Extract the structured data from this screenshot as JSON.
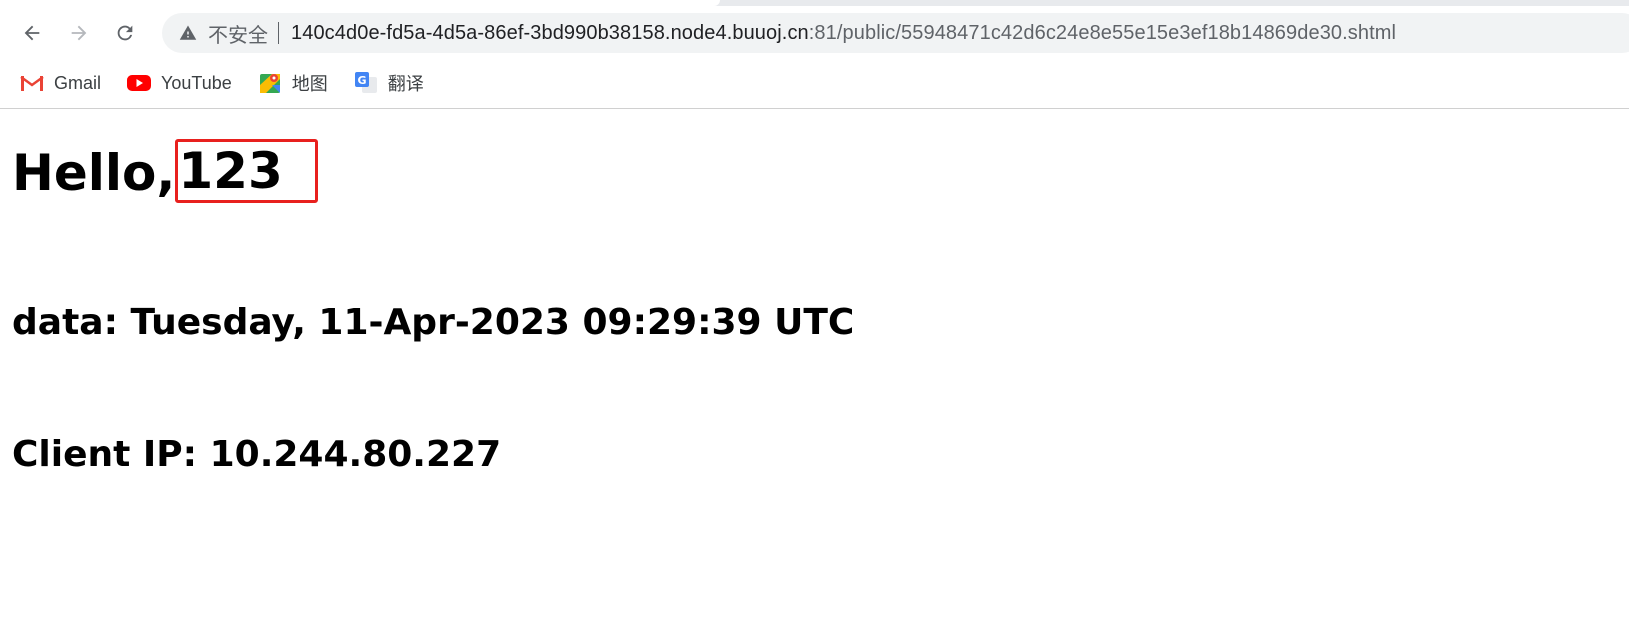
{
  "browser": {
    "security_label": "不安全",
    "url_host": "140c4d0e-fd5a-4d5a-86ef-3bd990b38158.node4.buuoj.cn",
    "url_rest": ":81/public/55948471c42d6c24e8e55e15e3ef18b14869de30.shtml",
    "bookmarks": [
      {
        "label": "Gmail",
        "icon": "gmail-icon"
      },
      {
        "label": "YouTube",
        "icon": "youtube-icon"
      },
      {
        "label": "地图",
        "icon": "maps-icon"
      },
      {
        "label": "翻译",
        "icon": "translate-icon"
      }
    ]
  },
  "page": {
    "hello_prefix": "Hello,",
    "name_value": "123",
    "date_line": "data: Tuesday, 11-Apr-2023 09:29:39 UTC",
    "ip_line": "Client IP: 10.244.80.227"
  },
  "colors": {
    "highlight_box": "#e8201e",
    "omnibox_bg": "#f1f3f4"
  }
}
